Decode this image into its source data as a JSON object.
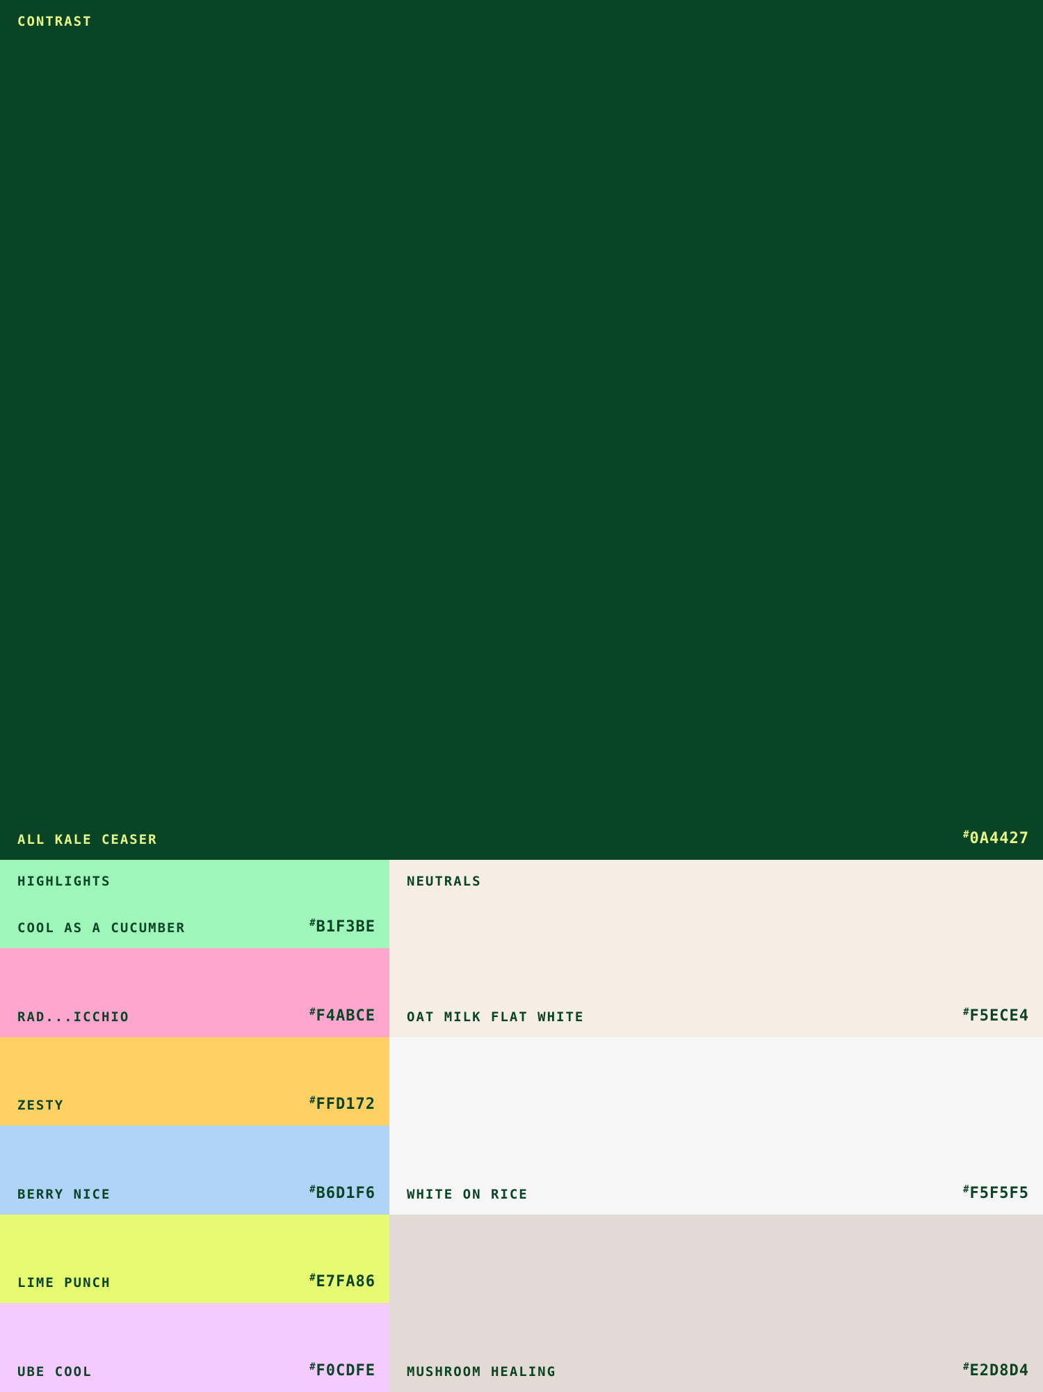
{
  "contrast": {
    "section_label": "CONTRAST",
    "name": "ALL KALE CEASER",
    "hex_symbol": "#",
    "hex": "0A4427",
    "color": "#0A4427",
    "text_color": "#E7FA86"
  },
  "highlights": {
    "section_label": "HIGHLIGHTS",
    "swatches": [
      {
        "name": "COOL AS A CUCUMBER",
        "hex_symbol": "#",
        "hex": "B1F3BE",
        "color": "#9FF6BA"
      },
      {
        "name": "RAD...ICCHIO",
        "hex_symbol": "#",
        "hex": "F4ABCE",
        "color": "#FFA6CE"
      },
      {
        "name": "ZESTY",
        "hex_symbol": "#",
        "hex": "FFD172",
        "color": "#FFD164"
      },
      {
        "name": "BERRY NICE",
        "hex_symbol": "#",
        "hex": "B6D1F6",
        "color": "#B0D3F8"
      },
      {
        "name": "LIME PUNCH",
        "hex_symbol": "#",
        "hex": "E7FA86",
        "color": "#E5FA71"
      },
      {
        "name": "UBE COOL",
        "hex_symbol": "#",
        "hex": "F0CDFE",
        "color": "#F5CBFF"
      }
    ]
  },
  "neutrals": {
    "section_label": "NEUTRALS",
    "swatches": [
      {
        "name": "OAT MILK FLAT WHITE",
        "hex_symbol": "#",
        "hex": "F5ECE4",
        "color": "#F6EDE5"
      },
      {
        "name": "WHITE ON RICE",
        "hex_symbol": "#",
        "hex": "F5F5F5",
        "color": "#F6F6F6"
      },
      {
        "name": "MUSHROOM HEALING",
        "hex_symbol": "#",
        "hex": "E2D8D4",
        "color": "#E3D9D5"
      }
    ]
  }
}
